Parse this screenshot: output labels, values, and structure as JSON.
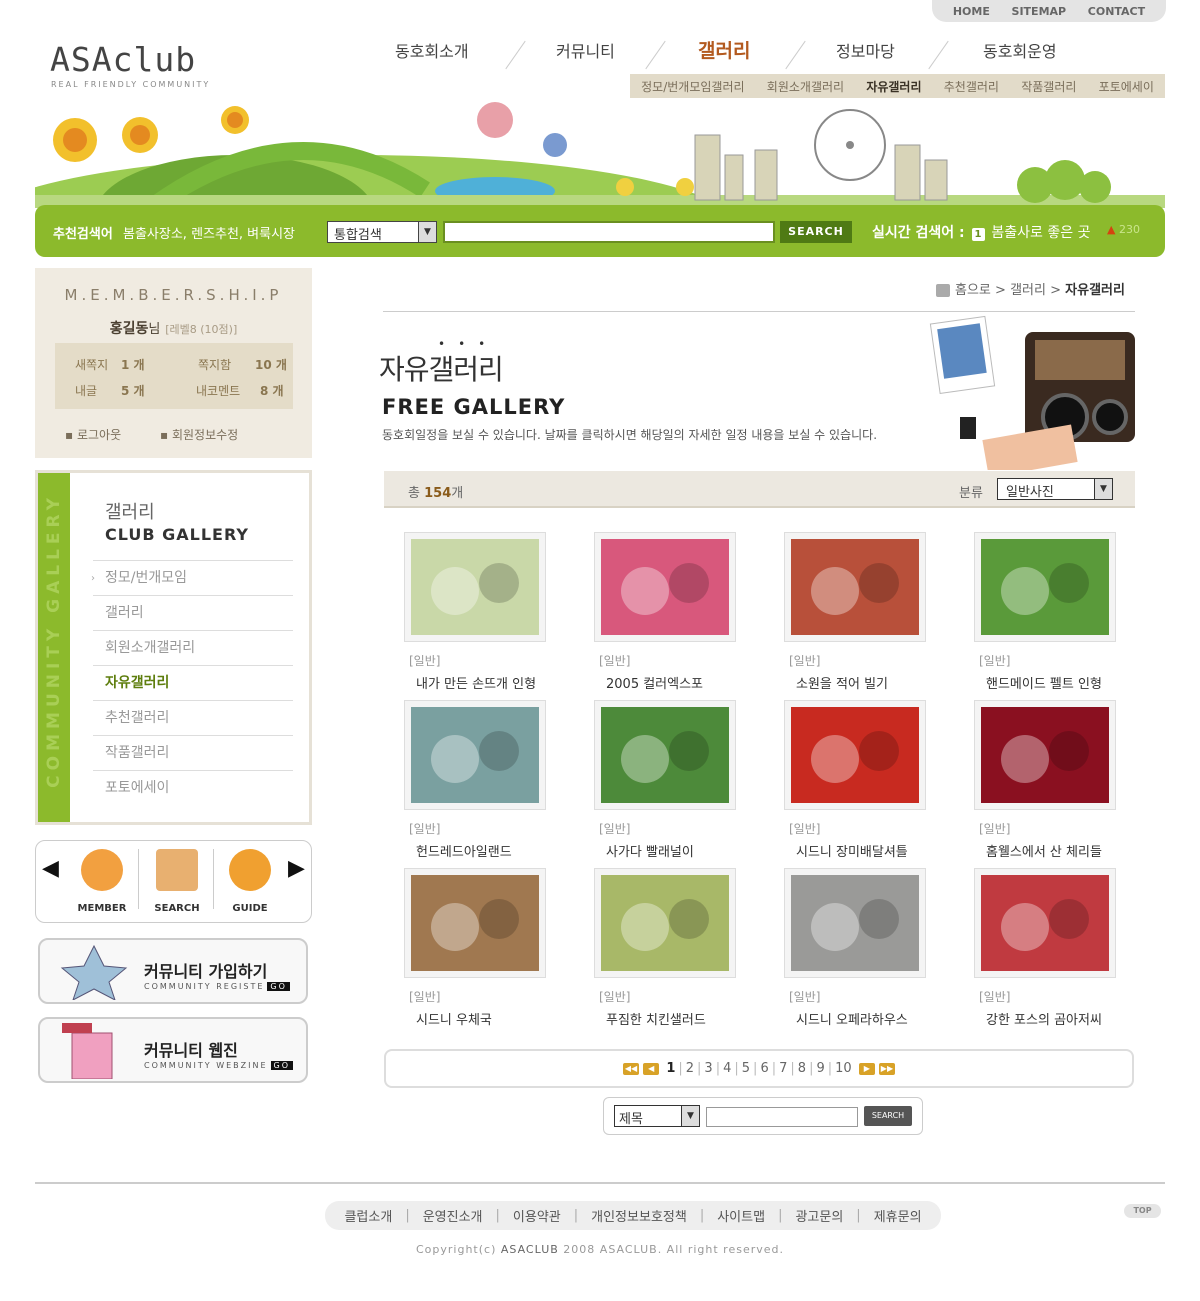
{
  "util": {
    "home": "HOME",
    "sitemap": "SITEMAP",
    "contact": "CONTACT"
  },
  "logo": {
    "title": "ASAclub",
    "subtitle": "REAL FRIENDLY COMMUNITY"
  },
  "gnb": [
    "동호회소개",
    "커뮤니티",
    "갤러리",
    "정보마당",
    "동호회운영"
  ],
  "gnb_active": "갤러리",
  "lnb": [
    "정모/번개모임갤러리",
    "회원소개갤러리",
    "자유갤러리",
    "추천갤러리",
    "작품갤러리",
    "포토에세이"
  ],
  "search": {
    "label": "추천검색어",
    "recommend": "봄출사장소, 렌즈추천, 벼룩시장",
    "select": "통합검색",
    "button": "SEARCH",
    "realtime_label": "실시간 검색어 :",
    "realtime_rank": "1",
    "realtime_item": "봄출사로 좋은 곳",
    "realtime_count": "230"
  },
  "membership": {
    "title": "M.E.M.B.E.R.S.H.I.P",
    "user": "홍길동",
    "user_suffix": "님",
    "level": "[레벨8 (10점)]",
    "new_note_label": "새쪽지",
    "new_note": "1 개",
    "note_box_label": "쪽지함",
    "note_box": "10 개",
    "my_post_label": "내글",
    "my_post": "5 개",
    "my_comment_label": "내코멘트",
    "my_comment": "8 개",
    "logout": "로그아웃",
    "edit": "회원정보수정"
  },
  "left_menu": {
    "vertical": "COMMUNITY GALLERY",
    "title_kr": "갤러리",
    "title_en": "CLUB GALLERY",
    "items": [
      "정모/번개모임",
      "갤러리",
      "회원소개갤러리",
      "자유갤러리",
      "추천갤러리",
      "작품갤러리",
      "포토에세이"
    ],
    "active": "자유갤러리"
  },
  "quick": {
    "member": "MEMBER",
    "search": "SEARCH",
    "guide": "GUIDE"
  },
  "banners": [
    {
      "title": "커뮤니티 가입하기",
      "sub": "COMMUNITY REGISTE",
      "go": "GO"
    },
    {
      "title": "커뮤니티 웹진",
      "sub": "COMMUNITY WEBZINE",
      "go": "GO"
    }
  ],
  "breadcrumb": {
    "home": "홈으로",
    "sep": ">",
    "mid": "갤러리",
    "current": "자유갤러리"
  },
  "page": {
    "title": "자유갤러리",
    "title_en": "FREE GALLERY",
    "desc": "동호회일정을 보실 수 있습니다. 날짜를 클릭하시면 해당일의 자세한 일정 내용을 보실 수 있습니다."
  },
  "list": {
    "total_prefix": "총",
    "total": "154",
    "total_suffix": "개",
    "cat_label": "분류",
    "cat_value": "일반사진"
  },
  "gallery": [
    {
      "cat": "[일반]",
      "title": "내가 만든 손뜨개 인형",
      "color": "#c9d8a8"
    },
    {
      "cat": "[일반]",
      "title": "2005 컬러엑스포",
      "color": "#d8587c"
    },
    {
      "cat": "[일반]",
      "title": "소원을 적어 빌기",
      "color": "#b8503a"
    },
    {
      "cat": "[일반]",
      "title": "핸드메이드 펠트 인형",
      "color": "#5a9a3a"
    },
    {
      "cat": "[일반]",
      "title": "헌드레드아일랜드",
      "color": "#7aa0a0"
    },
    {
      "cat": "[일반]",
      "title": "사가다 빨래널이",
      "color": "#4d8a3a"
    },
    {
      "cat": "[일반]",
      "title": "시드니 장미배달셔틀",
      "color": "#c82a20"
    },
    {
      "cat": "[일반]",
      "title": "홈웰스에서 산 체리들",
      "color": "#8a1020"
    },
    {
      "cat": "[일반]",
      "title": "시드니 우체국",
      "color": "#a07850"
    },
    {
      "cat": "[일반]",
      "title": "푸짐한 치킨샐러드",
      "color": "#a8b868"
    },
    {
      "cat": "[일반]",
      "title": "시드니 오페라하우스",
      "color": "#9a9a98"
    },
    {
      "cat": "[일반]",
      "title": "강한 포스의 곰아저씨",
      "color": "#c03a40"
    }
  ],
  "pager": {
    "pages": [
      "1",
      "2",
      "3",
      "4",
      "5",
      "6",
      "7",
      "8",
      "9",
      "10"
    ],
    "current": "1"
  },
  "bottom_search": {
    "select": "제목",
    "button": "SEARCH"
  },
  "footer": {
    "links": [
      "클럽소개",
      "운영진소개",
      "이용약관",
      "개인정보보호정책",
      "사이트맵",
      "광고문의",
      "제휴문의"
    ],
    "top": "TOP",
    "copy_prefix": "Copyright(c)",
    "copy_brand": "ASACLUB",
    "copy_suffix": "2008 ASACLUB. All right reserved."
  },
  "colors": {
    "accent_green": "#8cba2c",
    "accent_orange": "#b35a1f",
    "beige": "#f0ebe1"
  }
}
